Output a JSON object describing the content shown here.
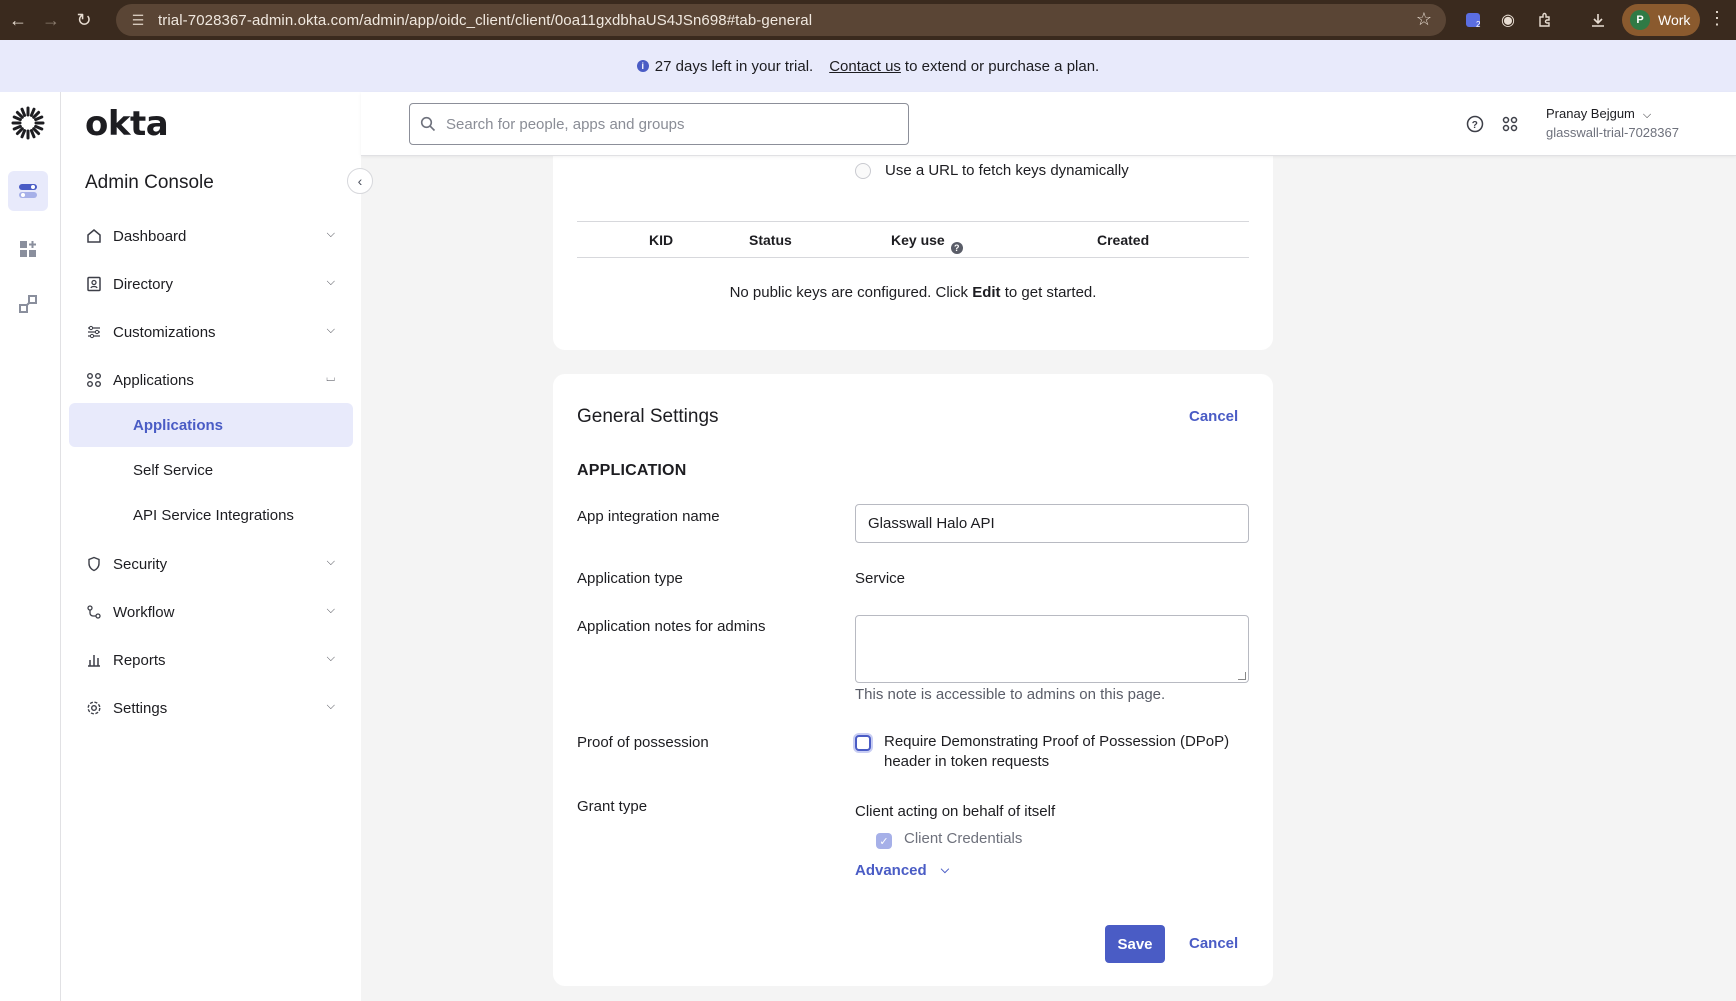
{
  "browser": {
    "url": "trial-7028367-admin.okta.com/admin/app/oidc_client/client/0oa11gxdbhaUS4JSn698#tab-general",
    "profile_label": "Work",
    "profile_initial": "P",
    "ext_badge": "2"
  },
  "banner": {
    "text": "27 days left in your trial.",
    "link": "Contact us",
    "suffix": "to extend or purchase a plan."
  },
  "sidebar": {
    "brand": "okta",
    "title": "Admin Console",
    "items": [
      {
        "label": "Dashboard",
        "icon": "home-icon"
      },
      {
        "label": "Directory",
        "icon": "directory-icon"
      },
      {
        "label": "Customizations",
        "icon": "sliders-icon"
      },
      {
        "label": "Applications",
        "icon": "apps-grid-icon"
      },
      {
        "label": "Security",
        "icon": "shield-icon"
      },
      {
        "label": "Workflow",
        "icon": "workflow-icon"
      },
      {
        "label": "Reports",
        "icon": "reports-icon"
      },
      {
        "label": "Settings",
        "icon": "gear-icon"
      }
    ],
    "sub_items": [
      "Applications",
      "Self Service",
      "API Service Integrations"
    ]
  },
  "header": {
    "search_placeholder": "Search for people, apps and groups",
    "user_name": "Pranay Bejgum",
    "user_org": "glasswall-trial-7028367"
  },
  "keys": {
    "radio_label": "Use a URL to fetch keys dynamically",
    "columns": [
      "KID",
      "Status",
      "Key use",
      "Created"
    ],
    "empty_prefix": "No public keys are configured. Click",
    "empty_bold": "Edit",
    "empty_suffix": "to get started."
  },
  "general": {
    "title": "General Settings",
    "cancel": "Cancel",
    "section": "APPLICATION",
    "app_name_label": "App integration name",
    "app_name_value": "Glasswall Halo API",
    "app_type_label": "Application type",
    "app_type_value": "Service",
    "notes_label": "Application notes for admins",
    "notes_hint": "This note is accessible to admins on this page.",
    "pop_label": "Proof of possession",
    "pop_checkbox": "Require Demonstrating Proof of Possession (DPoP) header in token requests",
    "grant_label": "Grant type",
    "grant_heading": "Client acting on behalf of itself",
    "grant_option": "Client Credentials",
    "advanced": "Advanced",
    "save": "Save"
  },
  "colors": {
    "accent": "#4a5cc5",
    "banner_bg": "#e8eafb",
    "chrome_bg": "#3a2a1e"
  }
}
